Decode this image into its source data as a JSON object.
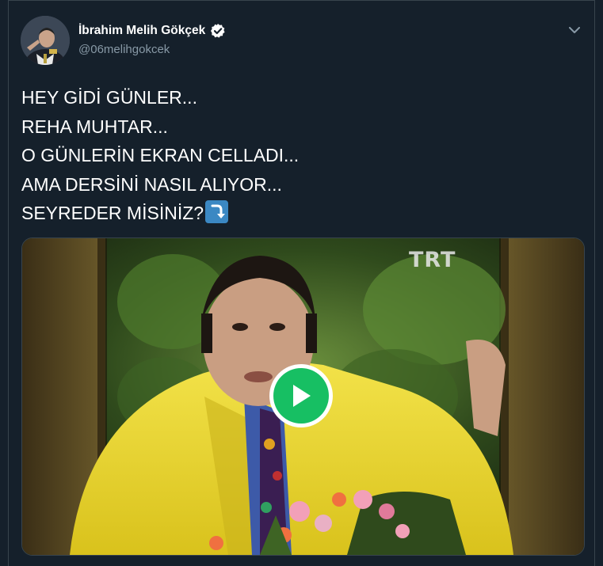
{
  "tweet": {
    "author": {
      "display_name": "İbrahim Melih Gökçek",
      "handle": "@06melihgokcek",
      "verified": true,
      "avatar_icon": "profile-photo"
    },
    "menu_icon": "chevron-down-icon",
    "text_lines": [
      "HEY GİDİ GÜNLER...",
      "REHA MUHTAR...",
      "O GÜNLERİN EKRAN CELLADI...",
      "AMA DERSİNİ NASIL ALIYOR...",
      "SEYREDER MİSİNİZ?"
    ],
    "trailing_emoji": "right-arrow-curving-down-emoji",
    "media": {
      "type": "video",
      "watermark": "TRT",
      "play_icon": "play-icon"
    }
  },
  "colors": {
    "background": "#15202b",
    "border": "#38444d",
    "primary_text": "#ffffff",
    "secondary_text": "#8899a6",
    "play_green": "#17bf63",
    "verified_blue": "#1da1f2"
  }
}
